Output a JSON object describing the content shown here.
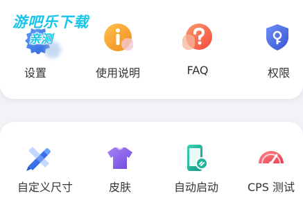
{
  "sections": {
    "top": [
      {
        "label": "设置",
        "icon": "gear-icon"
      },
      {
        "label": "使用说明",
        "icon": "info-icon"
      },
      {
        "label": "FAQ",
        "icon": "question-icon"
      },
      {
        "label": "权限",
        "icon": "shield-lock-icon"
      }
    ],
    "bottom": [
      {
        "label": "自定义尺寸",
        "icon": "ruler-pencil-icon"
      },
      {
        "label": "皮肤",
        "icon": "tshirt-icon"
      },
      {
        "label": "自动启动",
        "icon": "phone-link-icon"
      },
      {
        "label": "CPS 测试",
        "icon": "speedometer-icon"
      }
    ]
  },
  "watermark": {
    "line1": "游吧乐下载",
    "line2": "亲测"
  },
  "colors": {
    "background": "#f2f3f6",
    "card": "#ffffff",
    "label": "#333333",
    "gear": "#3d7be8",
    "info": "#f5a02a",
    "question": "#f46a4a",
    "shield": "#4a6ee0",
    "ruler": "#2f6ce6",
    "tshirt": "#8d62e8",
    "phone": "#1fb39a",
    "speedometer": "#f25d6a",
    "watermark": "#15c4e8"
  }
}
